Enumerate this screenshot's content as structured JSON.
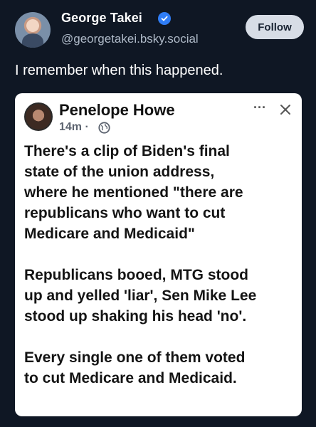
{
  "post": {
    "author_name": "George Takei",
    "handle": "@georgetakei.bsky.social",
    "follow_label": "Follow",
    "text": "I remember when this happened."
  },
  "embed": {
    "author_name": "Penelope Howe",
    "time": "14m ·",
    "more": "···",
    "paragraphs": [
      [
        "There's a clip of Biden's final",
        "state of the union address,",
        "where he mentioned \"there are",
        "republicans who want to cut",
        "Medicare and Medicaid\""
      ],
      [
        "Republicans booed, MTG stood",
        "up and yelled 'liar', Sen Mike Lee",
        "stood up shaking his head 'no'."
      ],
      [
        "Every single one of them voted",
        "to cut Medicare and Medicaid."
      ]
    ]
  },
  "colors": {
    "background": "#0f1724",
    "verified": "#2f7df6",
    "follow_button": "#d7dde6"
  }
}
